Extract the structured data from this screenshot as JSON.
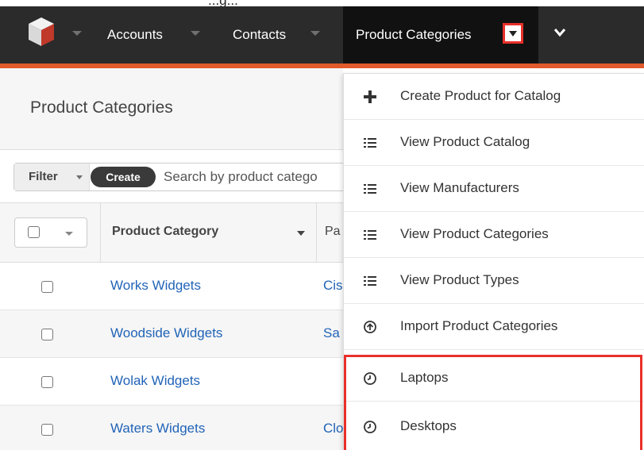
{
  "top_strip": {
    "fragment": "...g..."
  },
  "nav": {
    "items": [
      {
        "label": "Accounts"
      },
      {
        "label": "Contacts"
      },
      {
        "label": "Product Categories"
      }
    ]
  },
  "list": {
    "title": "Product Categories",
    "filter_label": "Filter",
    "create_label": "Create",
    "search_placeholder": "Search by product catego",
    "header": {
      "column_1": "Product Category",
      "column_2_fragment": "Pa"
    },
    "rows": [
      {
        "name": "Works Widgets",
        "next": "Cis"
      },
      {
        "name": "Woodside Widgets",
        "next": "Sa"
      },
      {
        "name": "Wolak Widgets",
        "next": ""
      },
      {
        "name": "Waters Widgets",
        "next": "Clo"
      }
    ]
  },
  "dropdown": {
    "items": [
      {
        "label": "Create Product for Catalog",
        "icon": "plus-icon"
      },
      {
        "label": "View Product Catalog",
        "icon": "list-icon"
      },
      {
        "label": "View Manufacturers",
        "icon": "list-icon"
      },
      {
        "label": "View Product Categories",
        "icon": "list-icon"
      },
      {
        "label": "View Product Types",
        "icon": "list-icon"
      },
      {
        "label": "Import Product Categories",
        "icon": "upload-circle-icon"
      },
      {
        "label": "Laptops",
        "icon": "clock-icon"
      },
      {
        "label": "Desktops",
        "icon": "clock-icon"
      }
    ]
  },
  "colors": {
    "navbar": "#2b2b2b",
    "nav_active": "#111111",
    "accent_bar": "#e05a2b",
    "highlight": "#e8302a",
    "link": "#2264b8"
  }
}
